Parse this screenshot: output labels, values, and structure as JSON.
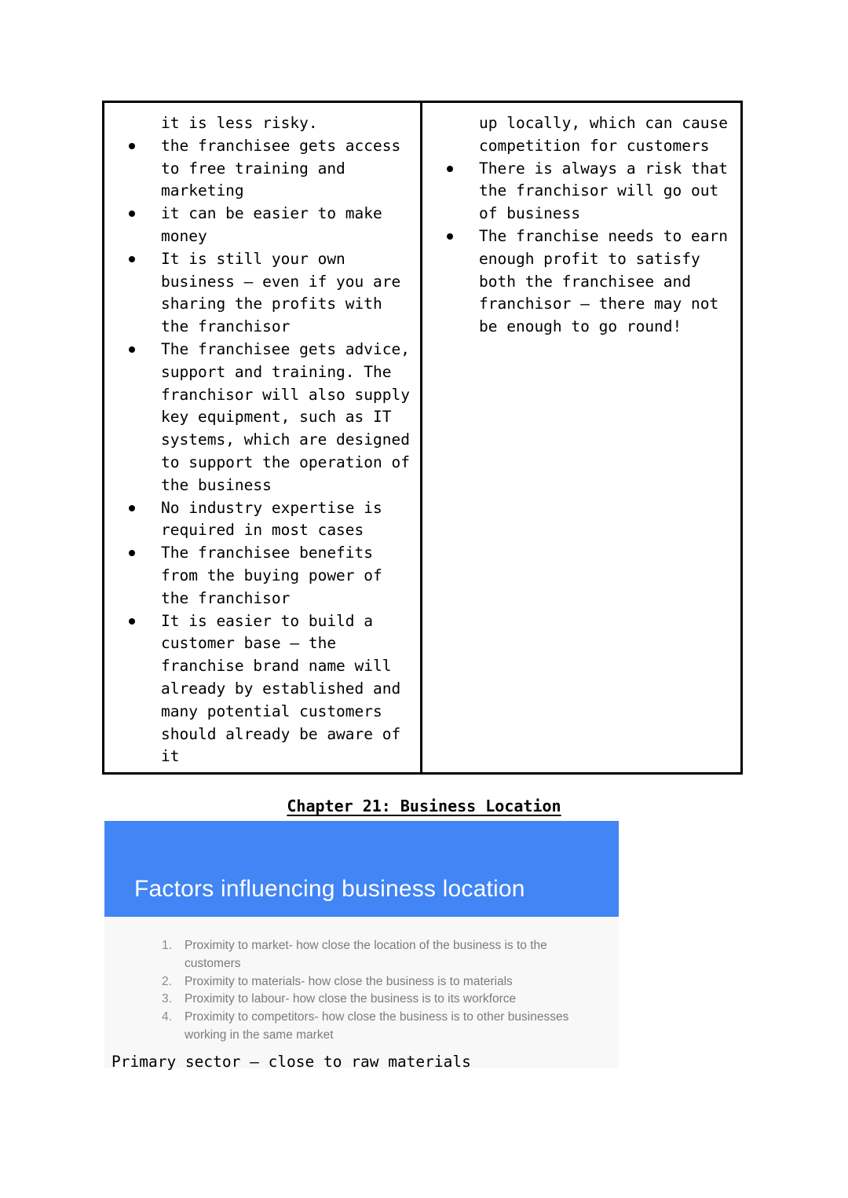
{
  "table": {
    "left_column": {
      "items": [
        {
          "text": "it is less risky.",
          "bullet": false
        },
        {
          "text": "the franchisee gets access to free training and marketing",
          "bullet": true
        },
        {
          "text": "it can be easier to make money",
          "bullet": true
        },
        {
          "text": "It is still your own business – even if you are sharing the profits with the franchisor",
          "bullet": true
        },
        {
          "text": "The franchisee gets advice, support and training. The franchisor will also supply key equipment, such as IT systems, which are designed to support the operation of the business",
          "bullet": true
        },
        {
          "text": "No industry expertise is required in most cases",
          "bullet": true
        },
        {
          "text": "The franchisee benefits from the buying power of the franchisor",
          "bullet": true
        },
        {
          "text": "It is easier to build a customer base – the franchise brand name will already by established and many potential customers should already be aware of it",
          "bullet": true
        }
      ]
    },
    "right_column": {
      "items": [
        {
          "text": "up locally, which can cause competition for customers",
          "bullet": false
        },
        {
          "text": "There is always a risk that the franchisor will go out of business",
          "bullet": true
        },
        {
          "text": "The franchise needs to earn enough profit to satisfy both the franchisee and franchisor – there may not be enough to go round!",
          "bullet": true
        }
      ]
    }
  },
  "chapter_heading": "Chapter 21: Business Location",
  "slide": {
    "banner_title": "Factors influencing business location",
    "banner_color": "#4285F4",
    "body_background": "#F8F8F8",
    "list": [
      "Proximity to market- how close the location of the business is to the customers",
      "Proximity to materials- how close the business is to materials",
      "Proximity to labour- how close the business is to its workforce",
      "Proximity to competitors- how close the business is to other businesses working in the same market"
    ]
  },
  "caption_line": "Primary sector – close to raw materials"
}
